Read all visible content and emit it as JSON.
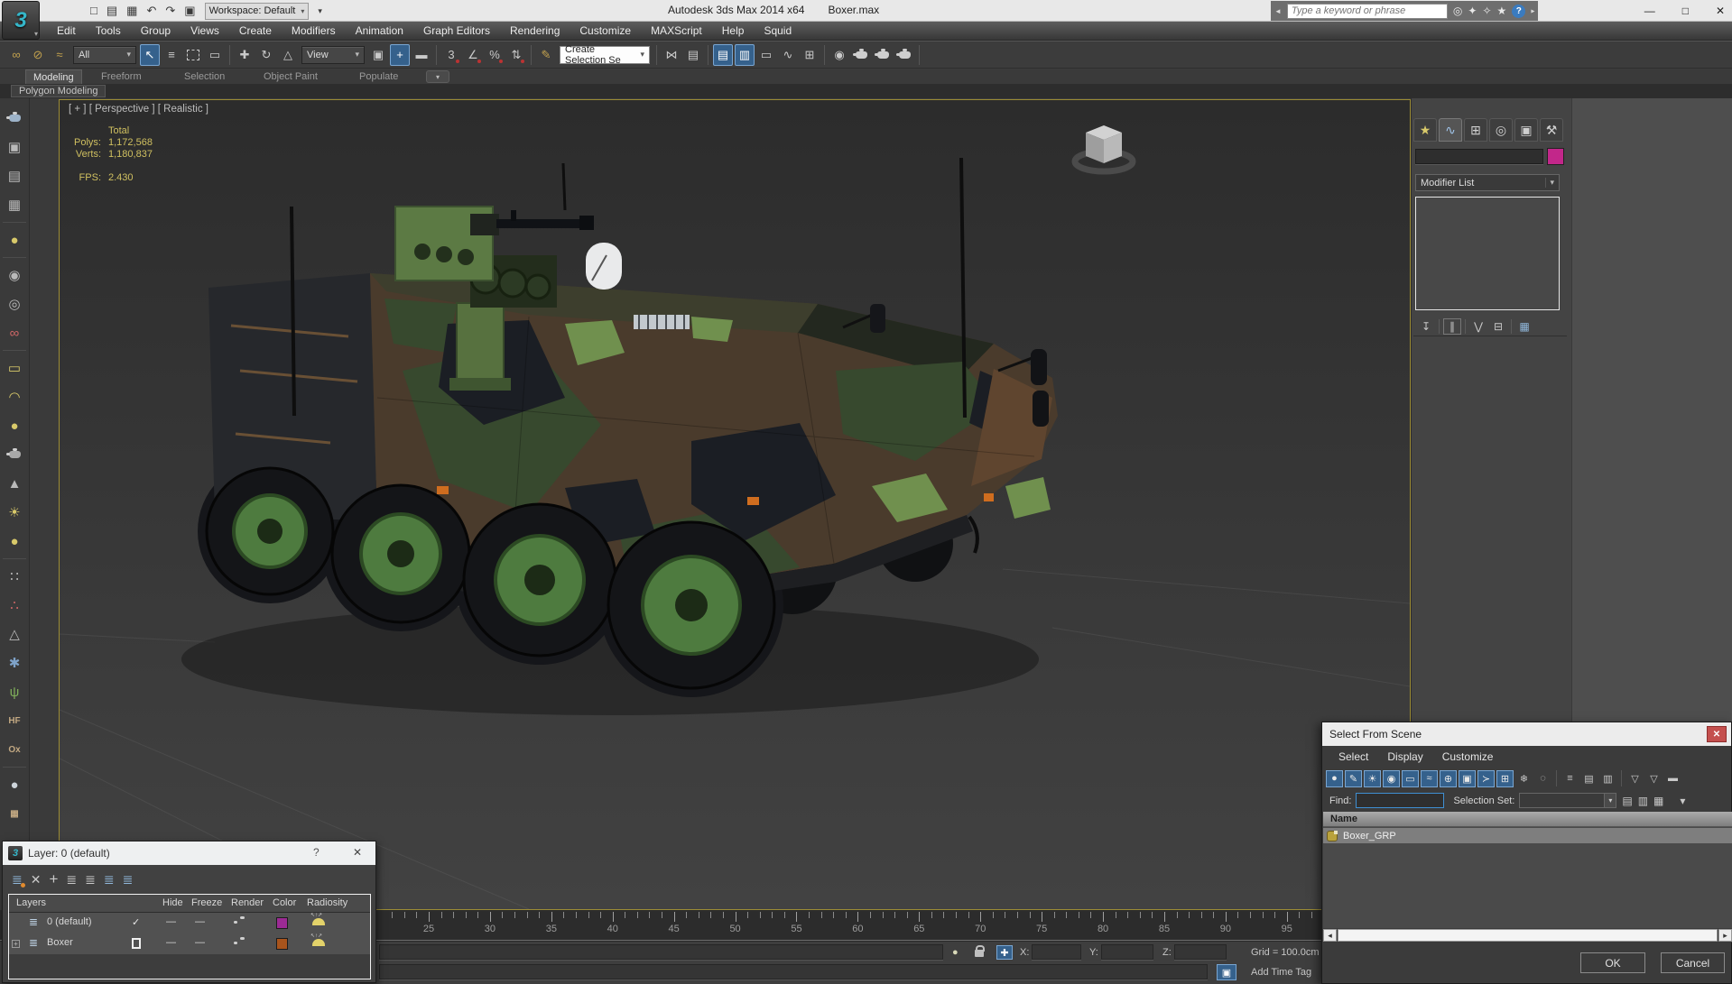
{
  "titlebar": {
    "app_title": "Autodesk 3ds Max 2014 x64",
    "doc_title": "Boxer.max",
    "workspace": "Workspace: Default",
    "search_placeholder": "Type a keyword or phrase"
  },
  "menubar": {
    "items": [
      "Edit",
      "Tools",
      "Group",
      "Views",
      "Create",
      "Modifiers",
      "Animation",
      "Graph Editors",
      "Rendering",
      "Customize",
      "MAXScript",
      "Help",
      "Squid"
    ]
  },
  "toolbar": {
    "selection_filter": "All",
    "ref_coord_system": "View",
    "named_selection_sets": "Create Selection Se",
    "snaps_label": "3"
  },
  "ribbon": {
    "tabs": [
      "Modeling",
      "Freeform",
      "Selection",
      "Object Paint",
      "Populate"
    ],
    "active_tab": "Modeling",
    "panel_button": "Polygon Modeling"
  },
  "viewport": {
    "label": "[ + ] [ Perspective ] [ Realistic ]",
    "stats": {
      "total_header": "Total",
      "polys_label": "Polys:",
      "polys_value": "1,172,568",
      "verts_label": "Verts:",
      "verts_value": "1,180,837",
      "fps_label": "FPS:",
      "fps_value": "2.430"
    }
  },
  "command_panel": {
    "modifier_list": "Modifier List",
    "object_name": "",
    "name_swatch_color": "#c2278a"
  },
  "timeline": {
    "labels": [
      "25",
      "30",
      "35",
      "40",
      "45",
      "50",
      "55",
      "60",
      "65",
      "70",
      "75",
      "80",
      "85",
      "90",
      "95"
    ]
  },
  "status_bar": {
    "x_label": "X:",
    "y_label": "Y:",
    "z_label": "Z:",
    "x_value": "",
    "y_value": "",
    "z_value": "",
    "grid_label": "Grid = 100.0cm",
    "add_time_tag": "Add Time Tag"
  },
  "layer_dialog": {
    "title": "Layer: 0 (default)",
    "help_button": "?",
    "columns": {
      "layers": "Layers",
      "hide": "Hide",
      "freeze": "Freeze",
      "render": "Render",
      "color": "Color",
      "radiosity": "Radiosity"
    },
    "rows": [
      {
        "name": "0 (default)",
        "current_mark": "✓",
        "hide": "—",
        "freeze": "—",
        "color": "#9c2a94"
      },
      {
        "name": "Boxer",
        "current_mark": "",
        "hide": "—",
        "freeze": "—",
        "color": "#a8541c"
      }
    ]
  },
  "select_dialog": {
    "title": "Select From Scene",
    "menus": [
      "Select",
      "Display",
      "Customize"
    ],
    "find_label": "Find:",
    "find_value": "",
    "selection_set_label": "Selection Set:",
    "selection_set_value": "",
    "name_column": "Name",
    "rows": [
      {
        "name": "Boxer_GRP"
      }
    ],
    "ok_label": "OK",
    "cancel_label": "Cancel"
  },
  "colors": {
    "accent_blue": "#35618c",
    "viewport_border": "#9c8c35",
    "stats_yellow": "#d0c060",
    "close_red": "#c4504e"
  },
  "icons": {
    "logo": "3",
    "logo_caret": "▾",
    "new_file": "□",
    "open_file": "▤",
    "save_file": "▦",
    "undo": "↶",
    "redo": "↷",
    "paste_project": "▣",
    "ws_caret": "▾",
    "search_side": "◄",
    "binoculars": "◎",
    "key": "✦",
    "comm": "✧",
    "star": "★",
    "help": "?",
    "help_caret": "▾",
    "minimize": "—",
    "maximize": "□",
    "close": "✕",
    "link": "∞",
    "unlink": "⊘",
    "bind_warp": "≈",
    "select_object": "↖",
    "select_by_name": "≡",
    "window_crossing": "▭",
    "move": "✚",
    "rotate": "↻",
    "scale": "△",
    "pivot_center": "▣",
    "manipulate": "+",
    "kb_override": "▬",
    "snap3": "3",
    "angle_snap": "∠",
    "percent_snap": "%",
    "spinner_snap": "⇅",
    "edit_sets": "✎",
    "mirror": "⋈",
    "align": "▤",
    "layers": "▤",
    "scene_explorer": "▥",
    "ribbon_toggle": "▭",
    "curve_editor": "∿",
    "schematic": "⊞",
    "material": "◉",
    "combo_caret": "▾",
    "rail_image": "▣",
    "rail_dialog": "▤",
    "rail_sheet": "▦",
    "rail_lamp": "●",
    "rail_camera": "◉",
    "rail_camera2": "◎",
    "rail_glasses": "∞",
    "rail_plane_light": "▭",
    "rail_dome_light": "◠",
    "rail_disc_light": "●",
    "rail_cone": "▲",
    "rail_sun": "☀",
    "rail_sphere": "●",
    "rail_array": "∷",
    "rail_molecule": "∴",
    "rail_pyramid": "△",
    "rail_rock": "✱",
    "rail_grass": "ψ",
    "rail_hf": "HF",
    "rail_ox": "Ox",
    "rail_sphere2": "●",
    "rail_palette": "▦",
    "tab_create": "★",
    "tab_modify": "∿",
    "tab_hierarchy": "⊞",
    "tab_motion": "◎",
    "tab_display": "▣",
    "tab_utilities": "⚒",
    "pin_stack": "↧",
    "show_end_result": "∥",
    "make_unique": "⋁",
    "remove_modifier": "⊟",
    "configure_sets": "▦",
    "lyr_new": "≣",
    "lyr_delete": "✕",
    "lyr_add": "+",
    "lyr_pick": "≣",
    "lyr_pick2": "≣",
    "lyr_select": "≣",
    "lyr_freeze": "≣",
    "sel_geometry": "●",
    "sel_shapes": "✎",
    "sel_lights": "☀",
    "sel_cameras": "◉",
    "sel_helpers": "▭",
    "sel_warps": "≈",
    "sel_groups": "⊕",
    "sel_xrefs": "▣",
    "sel_bones": "≻",
    "sel_containers": "⊞",
    "sel_frozen": "❄",
    "sel_hidden": "◌",
    "list_view1": "≡",
    "list_view2": "▤",
    "list_view3": "▥",
    "funnel": "▽",
    "funnel_box": "▽",
    "archive": "▬",
    "find_ico1": "▤",
    "find_ico2": "▥",
    "find_ico3": "▦",
    "find_caret": "▾",
    "hscroll_left": "◂",
    "hscroll_right": "▸",
    "bulb": "●",
    "abs_mode": "✚",
    "iso_cube": "▣"
  }
}
